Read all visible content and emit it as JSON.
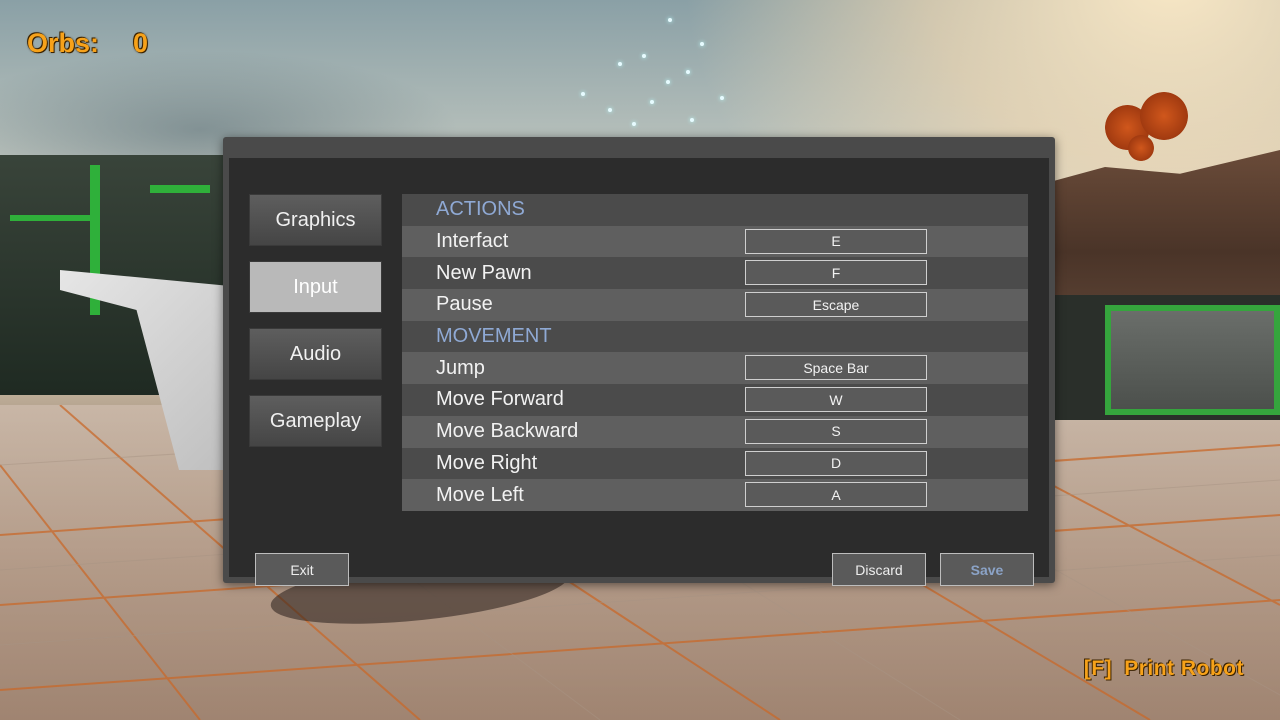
{
  "hud": {
    "orbs_label": "Orbs:",
    "orbs_value": "0",
    "print_key": "[F]",
    "print_label": "Print Robot",
    "accent_color": "#f7a21a"
  },
  "settings": {
    "tabs": [
      {
        "label": "Graphics",
        "active": false
      },
      {
        "label": "Input",
        "active": true
      },
      {
        "label": "Audio",
        "active": false
      },
      {
        "label": "Gameplay",
        "active": false
      }
    ],
    "rows": [
      {
        "type": "section",
        "label": "ACTIONS"
      },
      {
        "type": "binding",
        "label": "Interfact",
        "key": "E"
      },
      {
        "type": "binding",
        "label": "New Pawn",
        "key": "F"
      },
      {
        "type": "binding",
        "label": "Pause",
        "key": "Escape"
      },
      {
        "type": "section",
        "label": "MOVEMENT"
      },
      {
        "type": "binding",
        "label": "Jump",
        "key": "Space Bar"
      },
      {
        "type": "binding",
        "label": "Move Forward",
        "key": "W"
      },
      {
        "type": "binding",
        "label": "Move Backward",
        "key": "S"
      },
      {
        "type": "binding",
        "label": "Move Right",
        "key": "D"
      },
      {
        "type": "binding",
        "label": "Move Left",
        "key": "A"
      }
    ],
    "buttons": {
      "exit": "Exit",
      "discard": "Discard",
      "save": "Save"
    },
    "section_color": "#8fa9d4",
    "save_color": "#8ba3c7"
  }
}
